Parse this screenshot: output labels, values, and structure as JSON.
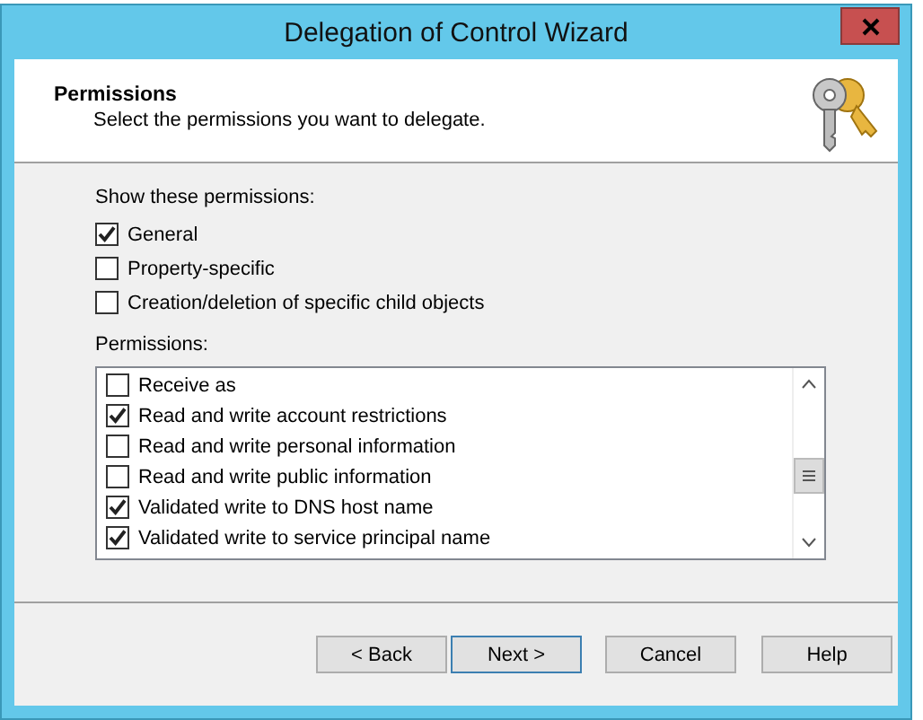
{
  "window": {
    "title": "Delegation of Control Wizard"
  },
  "header": {
    "title": "Permissions",
    "subtitle": "Select the permissions you want to delegate."
  },
  "show_label": "Show these permissions:",
  "show_options": [
    {
      "label": "General",
      "checked": true
    },
    {
      "label": "Property-specific",
      "checked": false
    },
    {
      "label": "Creation/deletion of specific child objects",
      "checked": false
    }
  ],
  "permissions_label": "Permissions:",
  "permissions": [
    {
      "label": "Receive as",
      "checked": false
    },
    {
      "label": "Read and write account restrictions",
      "checked": true
    },
    {
      "label": "Read and write personal information",
      "checked": false
    },
    {
      "label": "Read and write public information",
      "checked": false
    },
    {
      "label": "Validated write to DNS host name",
      "checked": true
    },
    {
      "label": "Validated write to service principal name",
      "checked": true
    }
  ],
  "buttons": [
    {
      "label": "< Back",
      "selected": false
    },
    {
      "label": "Next >",
      "selected": true
    },
    {
      "label": "Cancel",
      "selected": false
    },
    {
      "label": "Help",
      "selected": false
    }
  ]
}
